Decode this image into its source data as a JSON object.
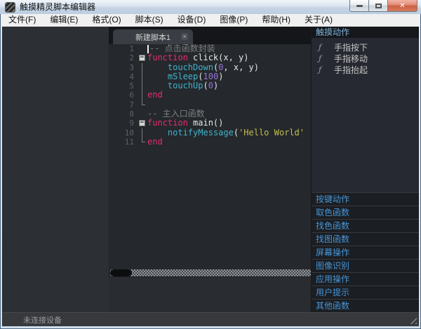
{
  "window": {
    "title": "触摸精灵脚本编辑器",
    "controls": {
      "minimize": "minimize",
      "maximize": "maximize",
      "close": "✕"
    }
  },
  "menu": {
    "items": [
      "文件(F)",
      "编辑(E)",
      "格式(O)",
      "脚本(S)",
      "设备(D)",
      "图像(P)",
      "帮助(H)",
      "关于(A)"
    ]
  },
  "editor": {
    "tab": {
      "label": "新建脚本1",
      "close_glyph": "×"
    },
    "fold_minus_glyph": "−",
    "lines": [
      {
        "n": "1",
        "fold": null,
        "caret": true,
        "tokens": [
          {
            "t": "-- 点击函数封装",
            "s": "comment"
          }
        ]
      },
      {
        "n": "2",
        "fold": "start",
        "caret": false,
        "tokens": [
          {
            "t": "function ",
            "s": "keyword"
          },
          {
            "t": "click(x, y)",
            "s": "plain"
          }
        ]
      },
      {
        "n": "3",
        "fold": "line",
        "caret": false,
        "tokens": [
          {
            "t": "    ",
            "s": "plain"
          },
          {
            "t": "touchDown",
            "s": "builtin"
          },
          {
            "t": "(",
            "s": "plain"
          },
          {
            "t": "0",
            "s": "number"
          },
          {
            "t": ", x, y)",
            "s": "plain"
          }
        ]
      },
      {
        "n": "4",
        "fold": "line",
        "caret": false,
        "tokens": [
          {
            "t": "    ",
            "s": "plain"
          },
          {
            "t": "mSleep",
            "s": "builtin"
          },
          {
            "t": "(",
            "s": "plain"
          },
          {
            "t": "100",
            "s": "number"
          },
          {
            "t": ")",
            "s": "plain"
          }
        ]
      },
      {
        "n": "5",
        "fold": "line",
        "caret": false,
        "tokens": [
          {
            "t": "    ",
            "s": "plain"
          },
          {
            "t": "touchUp",
            "s": "builtin"
          },
          {
            "t": "(",
            "s": "plain"
          },
          {
            "t": "0",
            "s": "number"
          },
          {
            "t": ")",
            "s": "plain"
          }
        ]
      },
      {
        "n": "6",
        "fold": "line",
        "caret": false,
        "tokens": [
          {
            "t": "end",
            "s": "keyword"
          }
        ]
      },
      {
        "n": "7",
        "fold": "end",
        "caret": false,
        "tokens": []
      },
      {
        "n": "8",
        "fold": null,
        "caret": false,
        "tokens": [
          {
            "t": "-- 主入口函数",
            "s": "comment"
          }
        ]
      },
      {
        "n": "9",
        "fold": "start",
        "caret": false,
        "tokens": [
          {
            "t": "function ",
            "s": "keyword"
          },
          {
            "t": "main()",
            "s": "plain"
          }
        ]
      },
      {
        "n": "10",
        "fold": "line",
        "caret": false,
        "tokens": [
          {
            "t": "    ",
            "s": "plain"
          },
          {
            "t": "notifyMessage",
            "s": "builtin"
          },
          {
            "t": "(",
            "s": "plain"
          },
          {
            "t": "'Hello World'",
            "s": "string"
          }
        ]
      },
      {
        "n": "11",
        "fold": "end",
        "caret": false,
        "tokens": [
          {
            "t": "end",
            "s": "keyword"
          }
        ]
      }
    ]
  },
  "sidebar": {
    "top_section": {
      "title": "触摸动作",
      "items": [
        {
          "icon": "ƒ",
          "label": "手指按下"
        },
        {
          "icon": "ƒ",
          "label": "手指移动"
        },
        {
          "icon": "ƒ",
          "label": "手指抬起"
        }
      ]
    },
    "collapsed_sections": [
      "按键动作",
      "取色函数",
      "找色函数",
      "找图函数",
      "屏幕操作",
      "图像识别",
      "应用操作",
      "用户提示",
      "其他函数"
    ]
  },
  "statusbar": {
    "text": "未连接设备"
  },
  "colors": {
    "keyword": "#e22e6f",
    "builtin": "#3fb3cd",
    "number": "#9572dd",
    "string": "#c3bf4e",
    "comment": "#7e7e7e",
    "plain": "#e6e6e6",
    "linenum": "#5e6267",
    "sidebar_header": "#7cb1d6",
    "section_header": "#4795d6",
    "close_button": "#cc5f43"
  }
}
